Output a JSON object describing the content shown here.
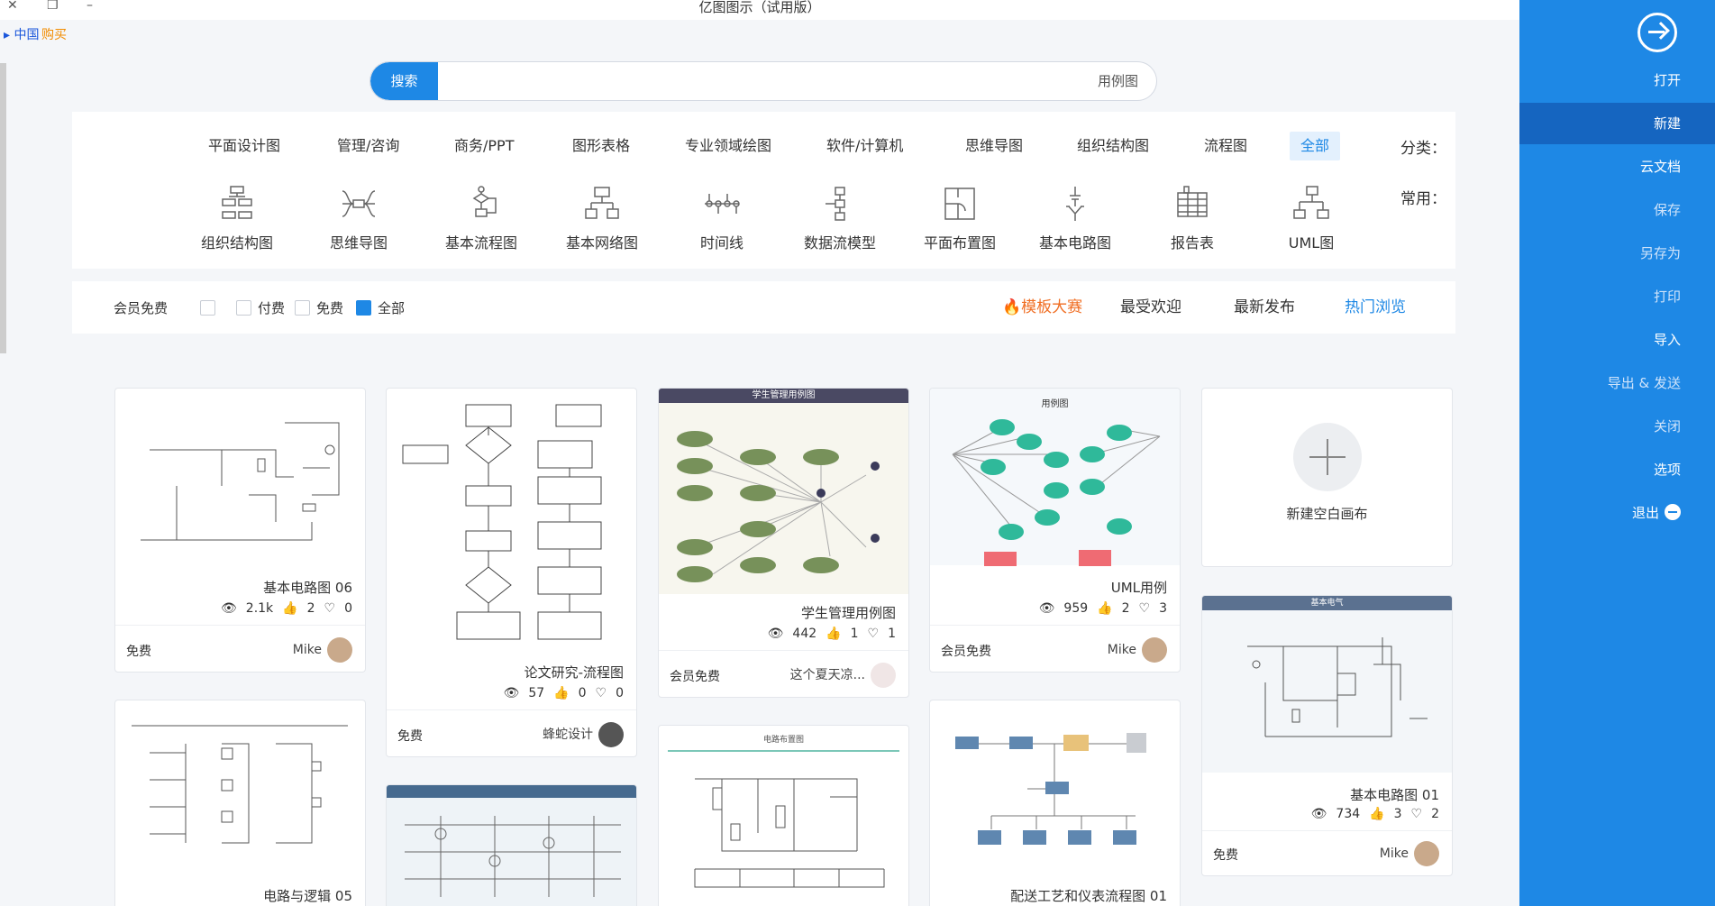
{
  "window": {
    "title": "亿图图示（试用版）",
    "buy_label": "购买",
    "lang_label": "中国"
  },
  "search": {
    "button_label": "搜索",
    "placeholder": "用例图"
  },
  "categories": {
    "label": "分类：",
    "items": [
      "全部",
      "流程图",
      "组织结构图",
      "思维导图",
      "软件/计算机",
      "专业领域绘图",
      "图形表格",
      "商务/PPT",
      "管理/咨询",
      "平面设计图"
    ],
    "common_label": "常用：",
    "common": [
      {
        "label": "UML图",
        "icon": "uml-icon"
      },
      {
        "label": "报告表",
        "icon": "report-table-icon"
      },
      {
        "label": "基本电路图",
        "icon": "circuit-icon"
      },
      {
        "label": "平面布置图",
        "icon": "floor-plan-icon"
      },
      {
        "label": "数据流模型",
        "icon": "data-flow-icon"
      },
      {
        "label": "时间线",
        "icon": "timeline-icon"
      },
      {
        "label": "基本网络图",
        "icon": "network-icon"
      },
      {
        "label": "基本流程图",
        "icon": "flowchart-icon"
      },
      {
        "label": "思维导图",
        "icon": "mindmap-icon"
      },
      {
        "label": "组织结构图",
        "icon": "org-chart-icon"
      }
    ]
  },
  "sort": {
    "hot": "热门浏览",
    "newest": "最新发布",
    "popular": "最受欢迎",
    "contest": "模板大赛"
  },
  "filters": {
    "all": "全部",
    "free": "免费",
    "paid": "付费",
    "member": "会员免费"
  },
  "new_canvas": {
    "label": "新建空白画布"
  },
  "cards": [
    {
      "name": "基本电路图 06",
      "views": "2.1k",
      "likes": "2",
      "favs": "0",
      "author": "Mike",
      "price": "免费"
    },
    {
      "name": "论文研究-流程图",
      "views": "57",
      "likes": "0",
      "favs": "0",
      "author": "蜂蛇设计",
      "price": "免费"
    },
    {
      "name": "学生管理用例图",
      "views": "442",
      "likes": "1",
      "favs": "1",
      "author": "这个夏天凉...",
      "price": "会员免费",
      "thumb_title": "学生管理用例图"
    },
    {
      "name": "UML用例",
      "views": "959",
      "likes": "2",
      "favs": "3",
      "author": "Mike",
      "price": "会员免费",
      "thumb_title": "用例图"
    },
    {
      "name": "基本电路图 01",
      "views": "734",
      "likes": "3",
      "favs": "2",
      "author": "Mike",
      "price": "免费",
      "thumb_title": "基本电气"
    },
    {
      "name": "电路与逻辑 05"
    },
    {
      "name": "配送工艺和仪表流程图 01"
    },
    {
      "thumb_title": "电路布置图"
    }
  ],
  "sidebar": {
    "items": [
      "打开",
      "新建",
      "云文档",
      "保存",
      "另存为",
      "打印",
      "导入",
      "导出 & 发送",
      "关闭",
      "选项",
      "退出"
    ]
  },
  "colors": {
    "accent": "#1e88e5",
    "contest": "#f06e23",
    "sidebar": "#1e88e5"
  }
}
